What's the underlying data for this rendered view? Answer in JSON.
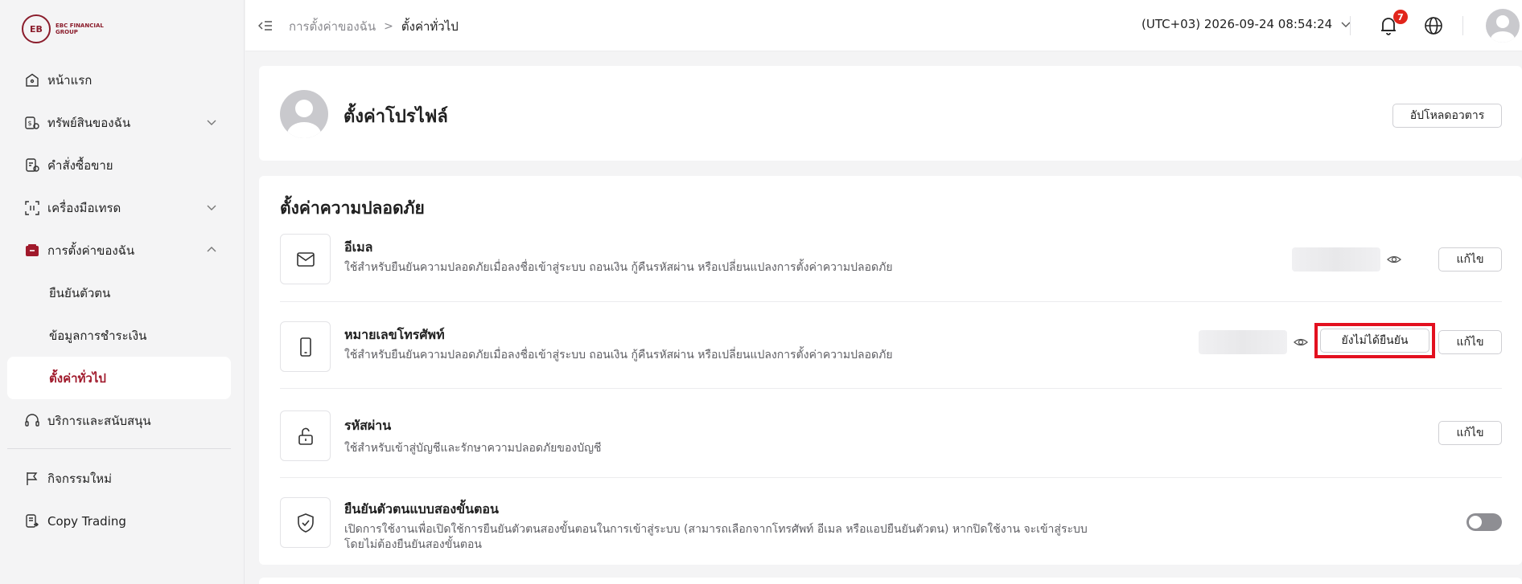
{
  "brand": {
    "mark": "EB",
    "text": "EBC FINANCIAL GROUP",
    "accent": "#a0192b"
  },
  "sidebar": {
    "items": [
      {
        "label": "หน้าแรก",
        "icon": "home-icon"
      },
      {
        "label": "ทรัพย์สินของฉัน",
        "icon": "assets-icon",
        "expandable": true
      },
      {
        "label": "คำสั่งซื้อขาย",
        "icon": "orders-icon"
      },
      {
        "label": "เครื่องมือเทรด",
        "icon": "tools-icon",
        "expandable": true
      },
      {
        "label": "การตั้งค่าของฉัน",
        "icon": "settings-box-icon",
        "expanded": true
      }
    ],
    "subitems": [
      {
        "label": "ยืนยันตัวตน"
      },
      {
        "label": "ข้อมูลการชำระเงิน"
      },
      {
        "label": "ตั้งค่าทั่วไป",
        "active": true
      }
    ],
    "support": {
      "label": "บริการและสนับสนุน",
      "icon": "headset-icon"
    },
    "extra": [
      {
        "label": "กิจกรรมใหม่",
        "icon": "flag-icon"
      },
      {
        "label": "Copy Trading",
        "icon": "copy-trading-icon"
      }
    ]
  },
  "topbar": {
    "breadcrumb": {
      "parent": "การตั้งค่าของฉัน",
      "separator": ">",
      "current": "ตั้งค่าทั่วไป"
    },
    "timezone": "(UTC+03)  2026-09-24 08:54:24",
    "notifications": "7"
  },
  "profile": {
    "title": "ตั้งค่าโปรไฟล์",
    "upload_label": "อัปโหลดอวตาร"
  },
  "security": {
    "title": "ตั้งค่าความปลอดภัย",
    "email": {
      "title": "อีเมล",
      "desc": "ใช้สำหรับยืนยันความปลอดภัยเมื่อลงชื่อเข้าสู่ระบบ ถอนเงิน กู้คืนรหัสผ่าน หรือเปลี่ยนแปลงการตั้งค่าความปลอดภัย",
      "edit_label": "แก้ไข"
    },
    "phone": {
      "title": "หมายเลขโทรศัพท์",
      "desc": "ใช้สำหรับยืนยันความปลอดภัยเมื่อลงชื่อเข้าสู่ระบบ ถอนเงิน กู้คืนรหัสผ่าน หรือเปลี่ยนแปลงการตั้งค่าความปลอดภัย",
      "verify_label": "ยังไม่ได้ยืนยัน",
      "edit_label": "แก้ไข"
    },
    "password": {
      "title": "รหัสผ่าน",
      "desc": "ใช้สำหรับเข้าสู่บัญชีและรักษาความปลอดภัยของบัญชี",
      "edit_label": "แก้ไข"
    },
    "two_factor": {
      "title": "ยืนยันตัวตนแบบสองขั้นตอน",
      "desc_line1": "เปิดการใช้งานเพื่อเปิดใช้การยืนยันตัวตนสองขั้นตอนในการเข้าสู่ระบบ (สามารถเลือกจากโทรศัพท์ อีเมล หรือแอปยืนยันตัวตน) หากปิดใช้งาน จะเข้าสู่ระบบ",
      "desc_line2": "โดยไม่ต้องยืนยันสองขั้นตอน",
      "enabled": false
    }
  }
}
